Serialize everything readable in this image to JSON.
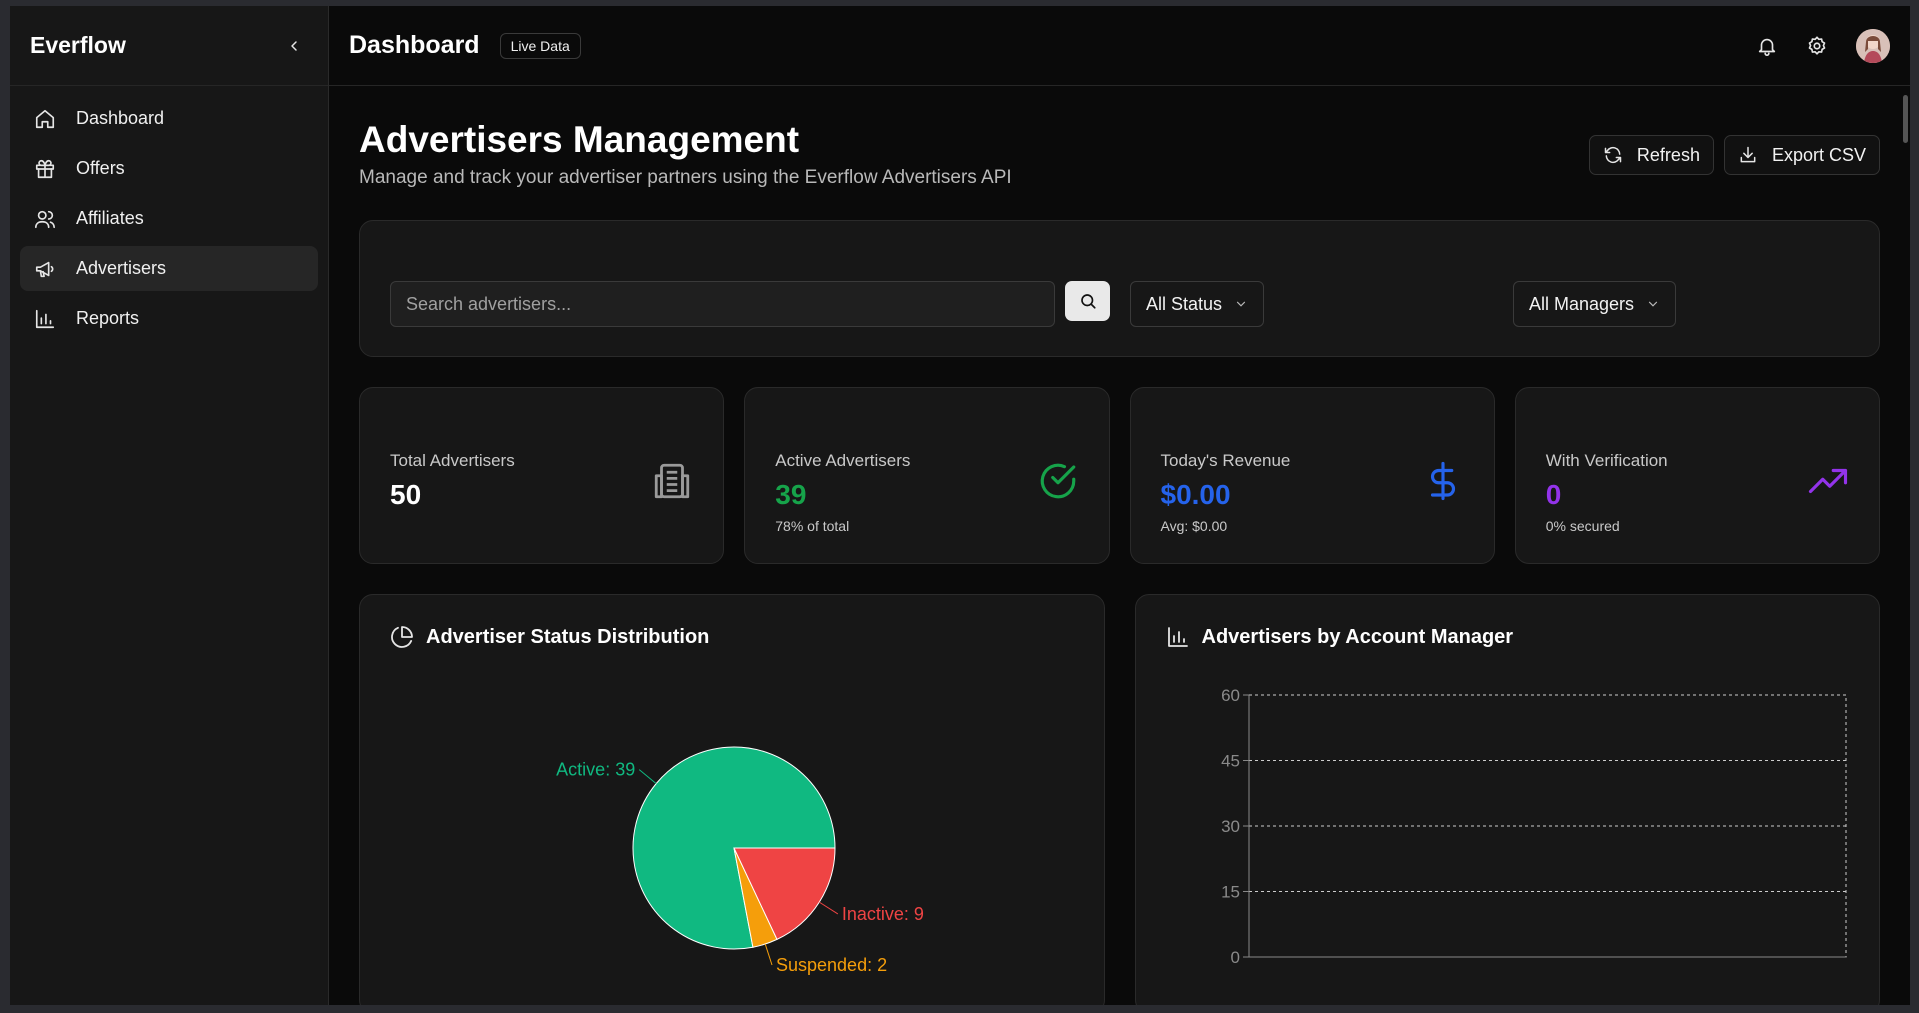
{
  "app": {
    "brand": "Everflow"
  },
  "sidebar": {
    "items": [
      {
        "label": "Dashboard",
        "icon": "home-icon"
      },
      {
        "label": "Offers",
        "icon": "gift-icon"
      },
      {
        "label": "Affiliates",
        "icon": "users-icon"
      },
      {
        "label": "Advertisers",
        "icon": "megaphone-icon",
        "active": true
      },
      {
        "label": "Reports",
        "icon": "bar-chart-icon"
      }
    ]
  },
  "topbar": {
    "title": "Dashboard",
    "badge": "Live Data"
  },
  "page": {
    "title": "Advertisers Management",
    "subtitle": "Manage and track your advertiser partners using the Everflow Advertisers API",
    "refresh_label": "Refresh",
    "export_label": "Export CSV"
  },
  "filters": {
    "search_placeholder": "Search advertisers...",
    "status_value": "All Status",
    "manager_value": "All Managers"
  },
  "stats": [
    {
      "label": "Total Advertisers",
      "value": "50",
      "sub": "",
      "color": "#ffffff",
      "icon": "building-icon"
    },
    {
      "label": "Active Advertisers",
      "value": "39",
      "sub": "78% of total",
      "color": "#16a34a",
      "icon": "check-circle-icon"
    },
    {
      "label": "Today's Revenue",
      "value": "$0.00",
      "sub": "Avg: $0.00",
      "color": "#2563eb",
      "icon": "dollar-icon"
    },
    {
      "label": "With Verification",
      "value": "0",
      "sub": "0% secured",
      "color": "#9333ea",
      "icon": "trending-up-icon"
    }
  ],
  "charts": {
    "pie_title": "Advertiser Status Distribution",
    "bar_title": "Advertisers by Account Manager"
  },
  "chart_data": [
    {
      "type": "pie",
      "title": "Advertiser Status Distribution",
      "slices": [
        {
          "label": "Active: 39",
          "name": "Active",
          "value": 39,
          "color": "#10b981"
        },
        {
          "label": "Suspended: 2",
          "name": "Suspended",
          "value": 2,
          "color": "#f59e0b"
        },
        {
          "label": "Inactive: 9",
          "name": "Inactive",
          "value": 9,
          "color": "#ef4444"
        }
      ]
    },
    {
      "type": "bar",
      "title": "Advertisers by Account Manager",
      "categories": [],
      "values": [],
      "ylim": [
        0,
        60
      ],
      "yticks": [
        "0",
        "15",
        "30",
        "45",
        "60"
      ],
      "grid": true
    }
  ]
}
